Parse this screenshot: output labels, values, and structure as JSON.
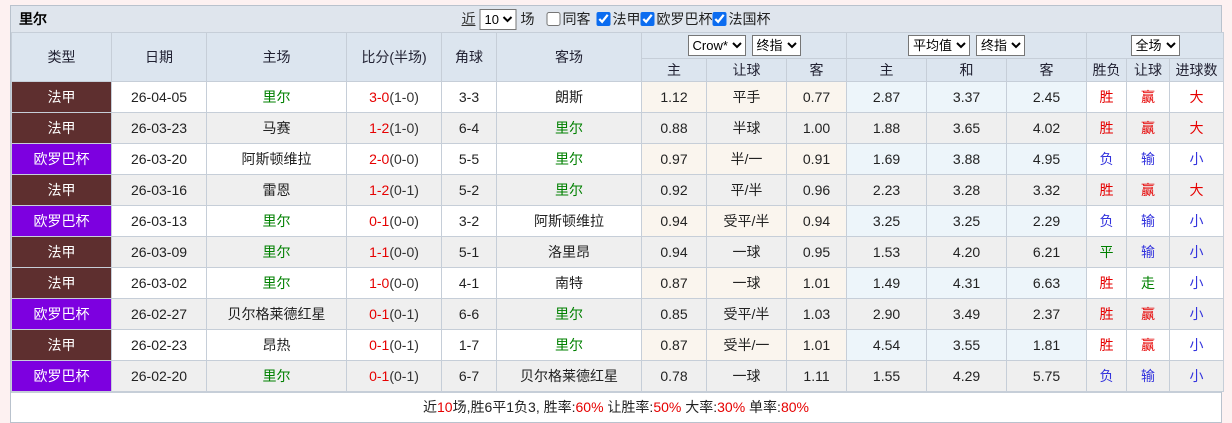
{
  "toolbar": {
    "team": "里尔",
    "recent_prefix": "近",
    "recent_value": "10",
    "recent_suffix": "场",
    "filters": [
      {
        "label": "同客",
        "checked": false
      },
      {
        "label": "法甲",
        "checked": true
      },
      {
        "label": "欧罗巴杯",
        "checked": true
      },
      {
        "label": "法国杯",
        "checked": true
      }
    ]
  },
  "table": {
    "main_headers": [
      "类型",
      "日期",
      "主场",
      "比分(半场)",
      "角球",
      "客场"
    ],
    "groups": [
      {
        "selects": [
          "Crow*",
          "终指"
        ],
        "subcols": [
          "主",
          "让球",
          "客"
        ]
      },
      {
        "selects": [
          "平均值",
          "终指"
        ],
        "subcols": [
          "主",
          "和",
          "客"
        ]
      },
      {
        "selects": [
          "全场"
        ],
        "subcols": [
          "胜负",
          "让球",
          "进球数"
        ]
      }
    ]
  },
  "rows": [
    {
      "type": "法甲",
      "league": "ligue1",
      "date": "26-04-05",
      "home": "里尔",
      "home_self": true,
      "ft": "3-0",
      "ht": "(1-0)",
      "corners": "3-3",
      "away": "朗斯",
      "away_self": false,
      "odds": [
        "1.12",
        "平手",
        "0.77"
      ],
      "avg": [
        "2.87",
        "3.37",
        "2.45"
      ],
      "results": [
        [
          "胜",
          "r"
        ],
        [
          "赢",
          "r"
        ],
        [
          "大",
          "r"
        ]
      ]
    },
    {
      "type": "法甲",
      "league": "ligue1",
      "date": "26-03-23",
      "home": "马赛",
      "home_self": false,
      "ft": "1-2",
      "ht": "(1-0)",
      "corners": "6-4",
      "away": "里尔",
      "away_self": true,
      "odds": [
        "0.88",
        "半球",
        "1.00"
      ],
      "avg": [
        "1.88",
        "3.65",
        "4.02"
      ],
      "results": [
        [
          "胜",
          "r"
        ],
        [
          "赢",
          "r"
        ],
        [
          "大",
          "r"
        ]
      ]
    },
    {
      "type": "欧罗巴杯",
      "league": "europa",
      "date": "26-03-20",
      "home": "阿斯顿维拉",
      "home_self": false,
      "ft": "2-0",
      "ht": "(0-0)",
      "corners": "5-5",
      "away": "里尔",
      "away_self": true,
      "odds": [
        "0.97",
        "半/一",
        "0.91"
      ],
      "avg": [
        "1.69",
        "3.88",
        "4.95"
      ],
      "results": [
        [
          "负",
          "b"
        ],
        [
          "输",
          "b"
        ],
        [
          "小",
          "b"
        ]
      ]
    },
    {
      "type": "法甲",
      "league": "ligue1",
      "date": "26-03-16",
      "home": "雷恩",
      "home_self": false,
      "ft": "1-2",
      "ht": "(0-1)",
      "corners": "5-2",
      "away": "里尔",
      "away_self": true,
      "odds": [
        "0.92",
        "平/半",
        "0.96"
      ],
      "avg": [
        "2.23",
        "3.28",
        "3.32"
      ],
      "results": [
        [
          "胜",
          "r"
        ],
        [
          "赢",
          "r"
        ],
        [
          "大",
          "r"
        ]
      ]
    },
    {
      "type": "欧罗巴杯",
      "league": "europa",
      "date": "26-03-13",
      "home": "里尔",
      "home_self": true,
      "ft": "0-1",
      "ht": "(0-0)",
      "corners": "3-2",
      "away": "阿斯顿维拉",
      "away_self": false,
      "odds": [
        "0.94",
        "受平/半",
        "0.94"
      ],
      "avg": [
        "3.25",
        "3.25",
        "2.29"
      ],
      "results": [
        [
          "负",
          "b"
        ],
        [
          "输",
          "b"
        ],
        [
          "小",
          "b"
        ]
      ]
    },
    {
      "type": "法甲",
      "league": "ligue1",
      "date": "26-03-09",
      "home": "里尔",
      "home_self": true,
      "ft": "1-1",
      "ht": "(0-0)",
      "corners": "5-1",
      "away": "洛里昂",
      "away_self": false,
      "odds": [
        "0.94",
        "一球",
        "0.95"
      ],
      "avg": [
        "1.53",
        "4.20",
        "6.21"
      ],
      "results": [
        [
          "平",
          "g"
        ],
        [
          "输",
          "b"
        ],
        [
          "小",
          "b"
        ]
      ]
    },
    {
      "type": "法甲",
      "league": "ligue1",
      "date": "26-03-02",
      "home": "里尔",
      "home_self": true,
      "ft": "1-0",
      "ht": "(0-0)",
      "corners": "4-1",
      "away": "南特",
      "away_self": false,
      "odds": [
        "0.87",
        "一球",
        "1.01"
      ],
      "avg": [
        "1.49",
        "4.31",
        "6.63"
      ],
      "results": [
        [
          "胜",
          "r"
        ],
        [
          "走",
          "g"
        ],
        [
          "小",
          "b"
        ]
      ]
    },
    {
      "type": "欧罗巴杯",
      "league": "europa",
      "date": "26-02-27",
      "home": "贝尔格莱德红星",
      "home_self": false,
      "ft": "0-1",
      "ht": "(0-1)",
      "corners": "6-6",
      "away": "里尔",
      "away_self": true,
      "odds": [
        "0.85",
        "受平/半",
        "1.03"
      ],
      "avg": [
        "2.90",
        "3.49",
        "2.37"
      ],
      "results": [
        [
          "胜",
          "r"
        ],
        [
          "赢",
          "r"
        ],
        [
          "小",
          "b"
        ]
      ]
    },
    {
      "type": "法甲",
      "league": "ligue1",
      "date": "26-02-23",
      "home": "昂热",
      "home_self": false,
      "ft": "0-1",
      "ht": "(0-1)",
      "corners": "1-7",
      "away": "里尔",
      "away_self": true,
      "odds": [
        "0.87",
        "受半/一",
        "1.01"
      ],
      "avg": [
        "4.54",
        "3.55",
        "1.81"
      ],
      "results": [
        [
          "胜",
          "r"
        ],
        [
          "赢",
          "r"
        ],
        [
          "小",
          "b"
        ]
      ]
    },
    {
      "type": "欧罗巴杯",
      "league": "europa",
      "date": "26-02-20",
      "home": "里尔",
      "home_self": true,
      "ft": "0-1",
      "ht": "(0-1)",
      "corners": "6-7",
      "away": "贝尔格莱德红星",
      "away_self": false,
      "odds": [
        "0.78",
        "一球",
        "1.11"
      ],
      "avg": [
        "1.55",
        "4.29",
        "5.75"
      ],
      "results": [
        [
          "负",
          "b"
        ],
        [
          "输",
          "b"
        ],
        [
          "小",
          "b"
        ]
      ]
    }
  ],
  "footer": {
    "segments": [
      {
        "text": "近",
        "red": false
      },
      {
        "text": "10",
        "red": true
      },
      {
        "text": "场,胜6平1负3, 胜率:",
        "red": false
      },
      {
        "text": "60%",
        "red": true
      },
      {
        "text": " 让胜率:",
        "red": false
      },
      {
        "text": "50%",
        "red": true
      },
      {
        "text": " 大率:",
        "red": false
      },
      {
        "text": "30%",
        "red": true
      },
      {
        "text": " 单率:",
        "red": false
      },
      {
        "text": "80%",
        "red": true
      }
    ]
  },
  "colors": {
    "league_ligue1_bg": "#5e2f2f",
    "league_europa_bg": "#7d00e0",
    "self_team_text": "#008000",
    "win_text": "#e60000",
    "lose_text": "#3333dd",
    "draw_text": "#008000",
    "header_bg": "#dce5ef",
    "handicap_col_bg": "#faf5ee",
    "avg_col_bg": "#edf5fa",
    "page_bg": "#fdf1f1"
  }
}
